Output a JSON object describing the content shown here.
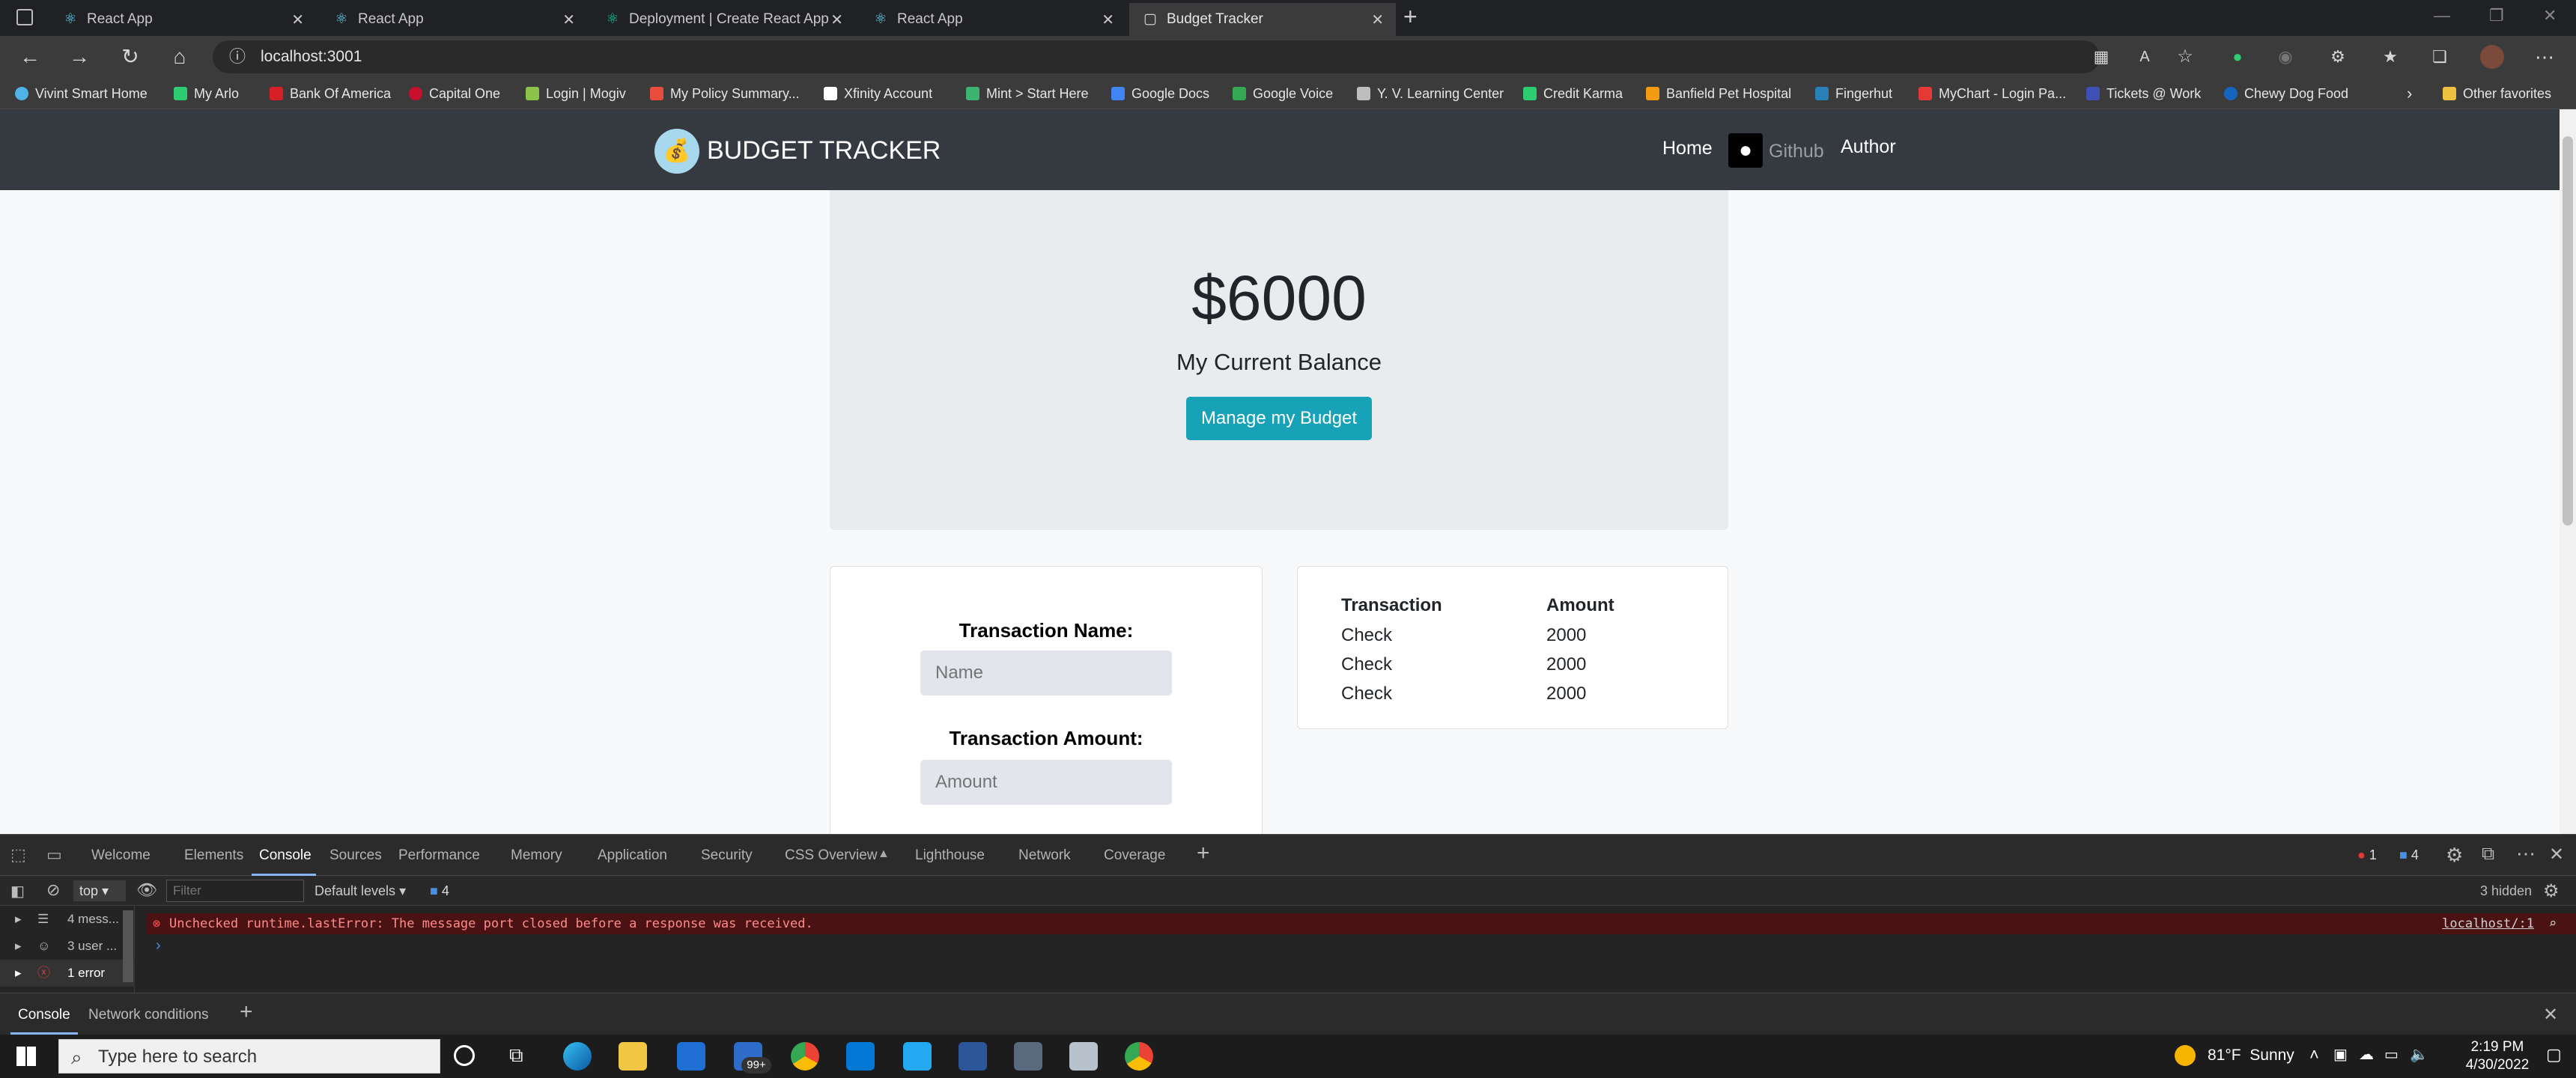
{
  "browser": {
    "tabs": [
      {
        "label": "React App"
      },
      {
        "label": "React App"
      },
      {
        "label": "Deployment | Create React App"
      },
      {
        "label": "React App"
      },
      {
        "label": "Budget Tracker"
      }
    ],
    "url": "localhost:3001",
    "bookmarks": [
      {
        "label": "Vivint Smart Home",
        "color": "#4fb3e8"
      },
      {
        "label": "My Arlo",
        "color": "#2ecc71"
      },
      {
        "label": "Bank Of America",
        "color": "#d61f26"
      },
      {
        "label": "Capital One",
        "color": "#c8102e"
      },
      {
        "label": "Login | Mogiv",
        "color": "#8bc34a"
      },
      {
        "label": "My Policy Summary...",
        "color": "#e74c3c"
      },
      {
        "label": "Xfinity Account",
        "color": "#ffffff"
      },
      {
        "label": "Mint > Start Here",
        "color": "#3cb371"
      },
      {
        "label": "Google Docs",
        "color": "#4285f4"
      },
      {
        "label": "Google Voice",
        "color": "#34a853"
      },
      {
        "label": "Y. V. Learning Center",
        "color": "#bdbdbd"
      },
      {
        "label": "Credit Karma",
        "color": "#2ecc71"
      },
      {
        "label": "Banfield Pet Hospital",
        "color": "#f39c12"
      },
      {
        "label": "Fingerhut",
        "color": "#2980b9"
      },
      {
        "label": "MyChart - Login Pa...",
        "color": "#e53935"
      },
      {
        "label": "Tickets @ Work",
        "color": "#3f51b5"
      },
      {
        "label": "Chewy Dog Food",
        "color": "#1565c0"
      }
    ],
    "other_favorites": "Other favorites"
  },
  "app": {
    "brand": "BUDGET TRACKER",
    "nav": {
      "home": "Home",
      "github": "Github",
      "author": "Author"
    },
    "balance": "$6000",
    "balance_label": "My Current Balance",
    "manage_button": "Manage my Budget",
    "form": {
      "name_label": "Transaction Name:",
      "name_placeholder": "Name",
      "amount_label": "Transaction Amount:",
      "amount_placeholder": "Amount"
    },
    "table": {
      "headers": [
        "Transaction",
        "Amount"
      ],
      "rows": [
        [
          "Check",
          "2000"
        ],
        [
          "Check",
          "2000"
        ],
        [
          "Check",
          "2000"
        ]
      ]
    }
  },
  "devtools": {
    "tabs": [
      "Welcome",
      "Elements",
      "Console",
      "Sources",
      "Performance",
      "Memory",
      "Application",
      "Security",
      "CSS Overview",
      "Lighthouse",
      "Network",
      "Coverage"
    ],
    "error_count": "1",
    "message_count": "4",
    "context": "top",
    "filter_placeholder": "Filter",
    "levels": "Default levels",
    "levels_badge": "4",
    "hidden": "3 hidden",
    "sidebar": [
      {
        "label": "4 mess..."
      },
      {
        "label": "3 user ..."
      },
      {
        "label": "1 error"
      }
    ],
    "error_message": "Unchecked runtime.lastError: The message port closed before a response was received.",
    "error_source": "localhost/:1",
    "drawer_tabs": [
      "Console",
      "Network conditions"
    ]
  },
  "taskbar": {
    "search_placeholder": "Type here to search",
    "mail_badge": "99+",
    "weather": "81°F  Sunny",
    "time": "2:19 PM",
    "date": "4/30/2022"
  }
}
